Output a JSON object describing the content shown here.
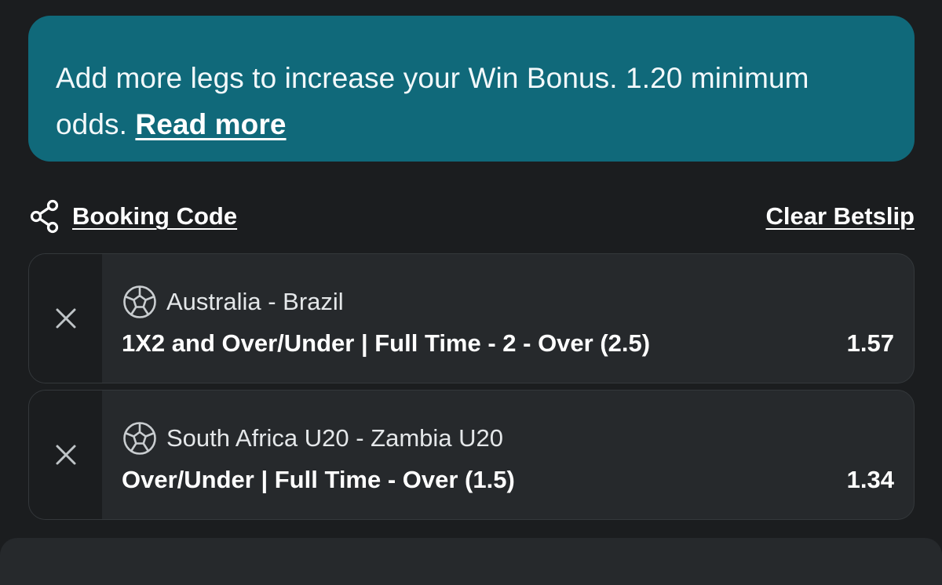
{
  "banner": {
    "message": "Add more legs to increase your Win Bonus. 1.20 minimum odds.",
    "link_label": "Read more"
  },
  "toolbar": {
    "booking_code_label": "Booking Code",
    "clear_label": "Clear Betslip",
    "share_icon": "share-icon"
  },
  "bets": [
    {
      "event": "Australia - Brazil",
      "market": "1X2 and Over/Under | Full Time - 2 - Over (2.5)",
      "odds": "1.57",
      "sport_icon": "soccer-ball-icon"
    },
    {
      "event": "South Africa U20 - Zambia U20",
      "market": "Over/Under | Full Time - Over (1.5)",
      "odds": "1.34",
      "sport_icon": "soccer-ball-icon"
    }
  ],
  "colors": {
    "background": "#1b1d1f",
    "banner": "#10697a",
    "card": "#26292c",
    "text": "#ffffff"
  }
}
